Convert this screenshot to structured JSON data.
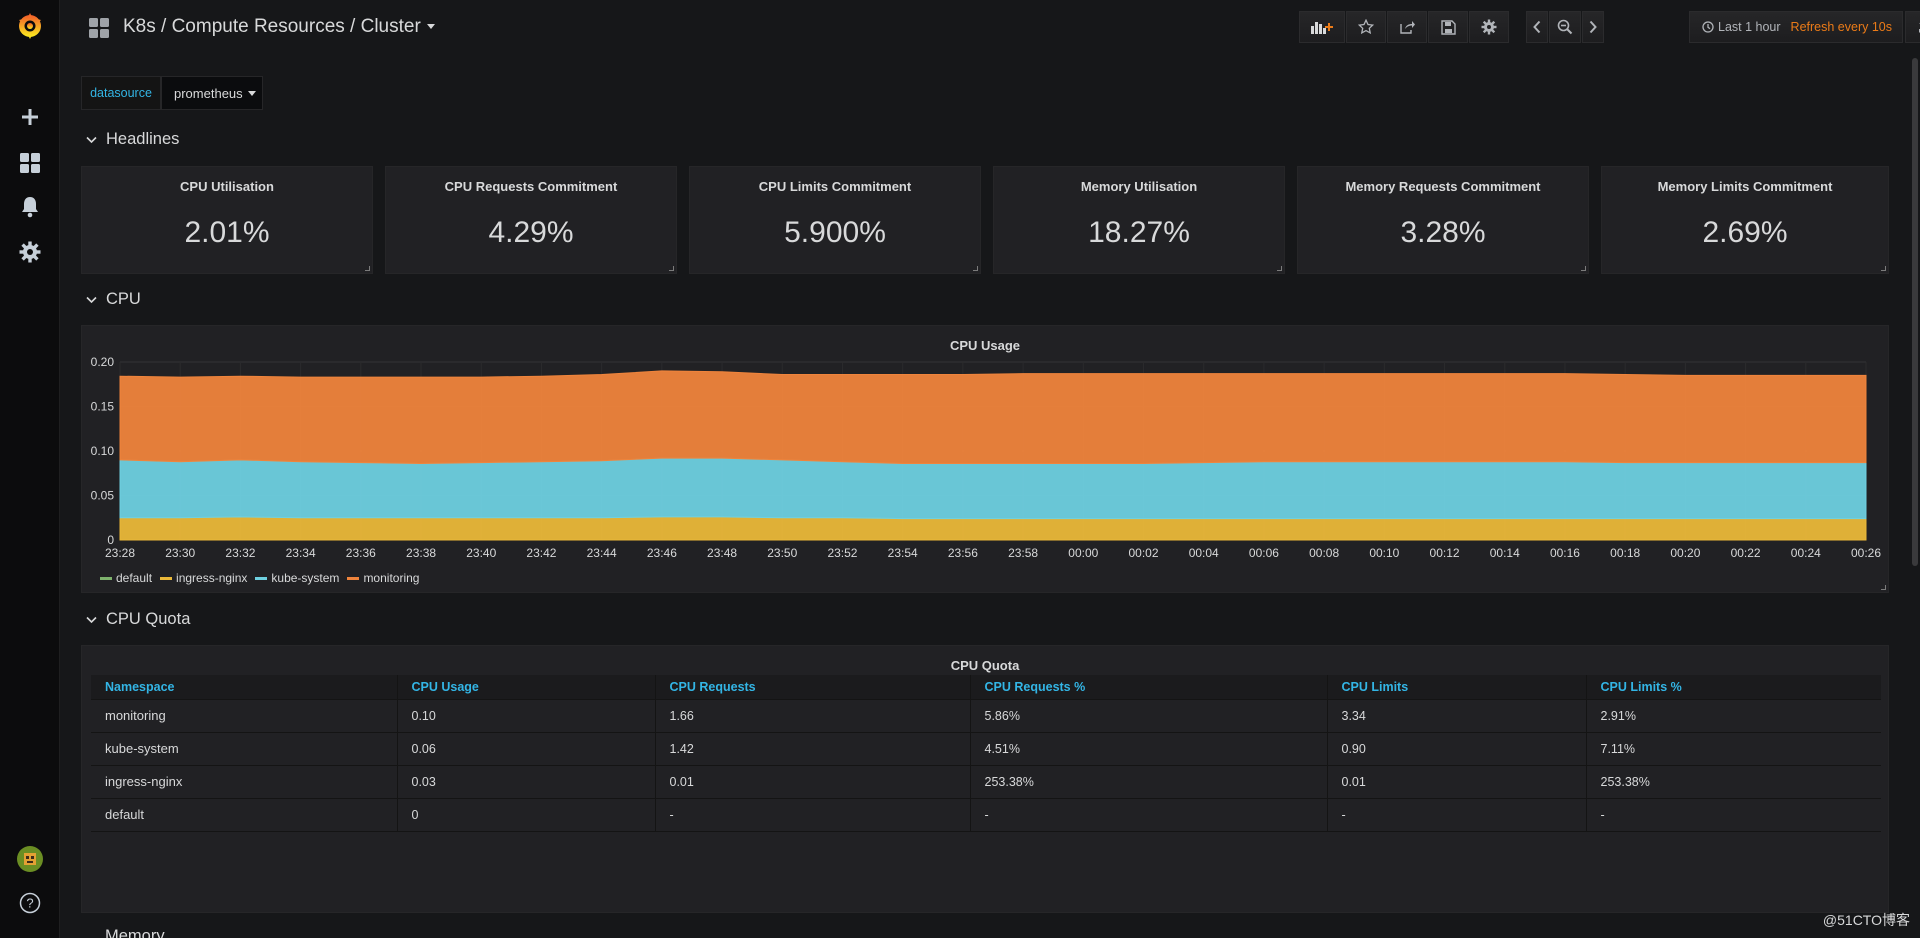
{
  "dashboard": {
    "title": "K8s / Compute Resources / Cluster"
  },
  "timepicker": {
    "range": "Last 1 hour",
    "refresh": "Refresh every 10s"
  },
  "variables": {
    "label": "datasource",
    "value": "prometheus"
  },
  "rows": {
    "headlines": "Headlines",
    "cpu": "CPU",
    "cpu_quota": "CPU Quota",
    "memory": "Memory"
  },
  "stats": [
    {
      "title": "CPU Utilisation",
      "value": "2.01%"
    },
    {
      "title": "CPU Requests Commitment",
      "value": "4.29%"
    },
    {
      "title": "CPU Limits Commitment",
      "value": "5.900%"
    },
    {
      "title": "Memory Utilisation",
      "value": "18.27%"
    },
    {
      "title": "Memory Requests Commitment",
      "value": "3.28%"
    },
    {
      "title": "Memory Limits Commitment",
      "value": "2.69%"
    }
  ],
  "chart_data": {
    "type": "area",
    "title": "CPU Usage",
    "stacked": true,
    "ylim": [
      0,
      0.2
    ],
    "yticks": [
      "0",
      "0.05",
      "0.10",
      "0.15",
      "0.20"
    ],
    "x": [
      "23:28",
      "23:30",
      "23:32",
      "23:34",
      "23:36",
      "23:38",
      "23:40",
      "23:42",
      "23:44",
      "23:46",
      "23:48",
      "23:50",
      "23:52",
      "23:54",
      "23:56",
      "23:58",
      "00:00",
      "00:02",
      "00:04",
      "00:06",
      "00:08",
      "00:10",
      "00:12",
      "00:14",
      "00:16",
      "00:18",
      "00:20",
      "00:22",
      "00:24",
      "00:26"
    ],
    "series": [
      {
        "name": "default",
        "color": "#7eb26d",
        "values": [
          0,
          0,
          0,
          0,
          0,
          0,
          0,
          0,
          0,
          0,
          0,
          0,
          0,
          0,
          0,
          0,
          0,
          0,
          0,
          0,
          0,
          0,
          0,
          0,
          0,
          0,
          0,
          0,
          0,
          0
        ]
      },
      {
        "name": "ingress-nginx",
        "color": "#eab839",
        "values": [
          0.025,
          0.025,
          0.026,
          0.025,
          0.025,
          0.025,
          0.025,
          0.025,
          0.025,
          0.026,
          0.026,
          0.025,
          0.025,
          0.024,
          0.024,
          0.024,
          0.024,
          0.024,
          0.024,
          0.024,
          0.024,
          0.024,
          0.024,
          0.024,
          0.024,
          0.024,
          0.024,
          0.024,
          0.024,
          0.024
        ]
      },
      {
        "name": "kube-system",
        "color": "#6ed0e0",
        "values": [
          0.065,
          0.063,
          0.064,
          0.063,
          0.062,
          0.061,
          0.062,
          0.063,
          0.064,
          0.066,
          0.066,
          0.065,
          0.063,
          0.062,
          0.062,
          0.062,
          0.062,
          0.062,
          0.063,
          0.064,
          0.064,
          0.064,
          0.064,
          0.064,
          0.064,
          0.063,
          0.063,
          0.063,
          0.063,
          0.063
        ]
      },
      {
        "name": "monitoring",
        "color": "#ef843c",
        "values": [
          0.094,
          0.095,
          0.094,
          0.095,
          0.096,
          0.097,
          0.096,
          0.096,
          0.097,
          0.098,
          0.097,
          0.096,
          0.098,
          0.1,
          0.1,
          0.101,
          0.101,
          0.101,
          0.1,
          0.099,
          0.099,
          0.099,
          0.099,
          0.099,
          0.099,
          0.099,
          0.098,
          0.098,
          0.098,
          0.098
        ]
      }
    ]
  },
  "quota_table": {
    "title": "CPU Quota",
    "columns": [
      "Namespace",
      "CPU Usage",
      "CPU Requests",
      "CPU Requests %",
      "CPU Limits",
      "CPU Limits %"
    ],
    "rows": [
      [
        "monitoring",
        "0.10",
        "1.66",
        "5.86%",
        "3.34",
        "2.91%"
      ],
      [
        "kube-system",
        "0.06",
        "1.42",
        "4.51%",
        "0.90",
        "7.11%"
      ],
      [
        "ingress-nginx",
        "0.03",
        "0.01",
        "253.38%",
        "0.01",
        "253.38%"
      ],
      [
        "default",
        "0",
        "-",
        "-",
        "-",
        "-"
      ]
    ]
  },
  "watermark": "@51CTO博客",
  "colors": {
    "accent_blue": "#33b5e5",
    "accent_orange": "#eb7b18",
    "panel_bg": "#212124",
    "page_bg": "#161719"
  },
  "icons": {
    "sidebar": [
      "grafana-logo-icon",
      "plus-icon",
      "dashboards-icon",
      "bell-icon",
      "gear-icon",
      "avatar",
      "help-icon"
    ],
    "toolbar": [
      "add-panel-icon",
      "star-icon",
      "share-icon",
      "save-icon",
      "settings-icon",
      "chevron-left-icon",
      "zoom-out-icon",
      "chevron-right-icon",
      "clock-icon",
      "refresh-icon"
    ]
  }
}
